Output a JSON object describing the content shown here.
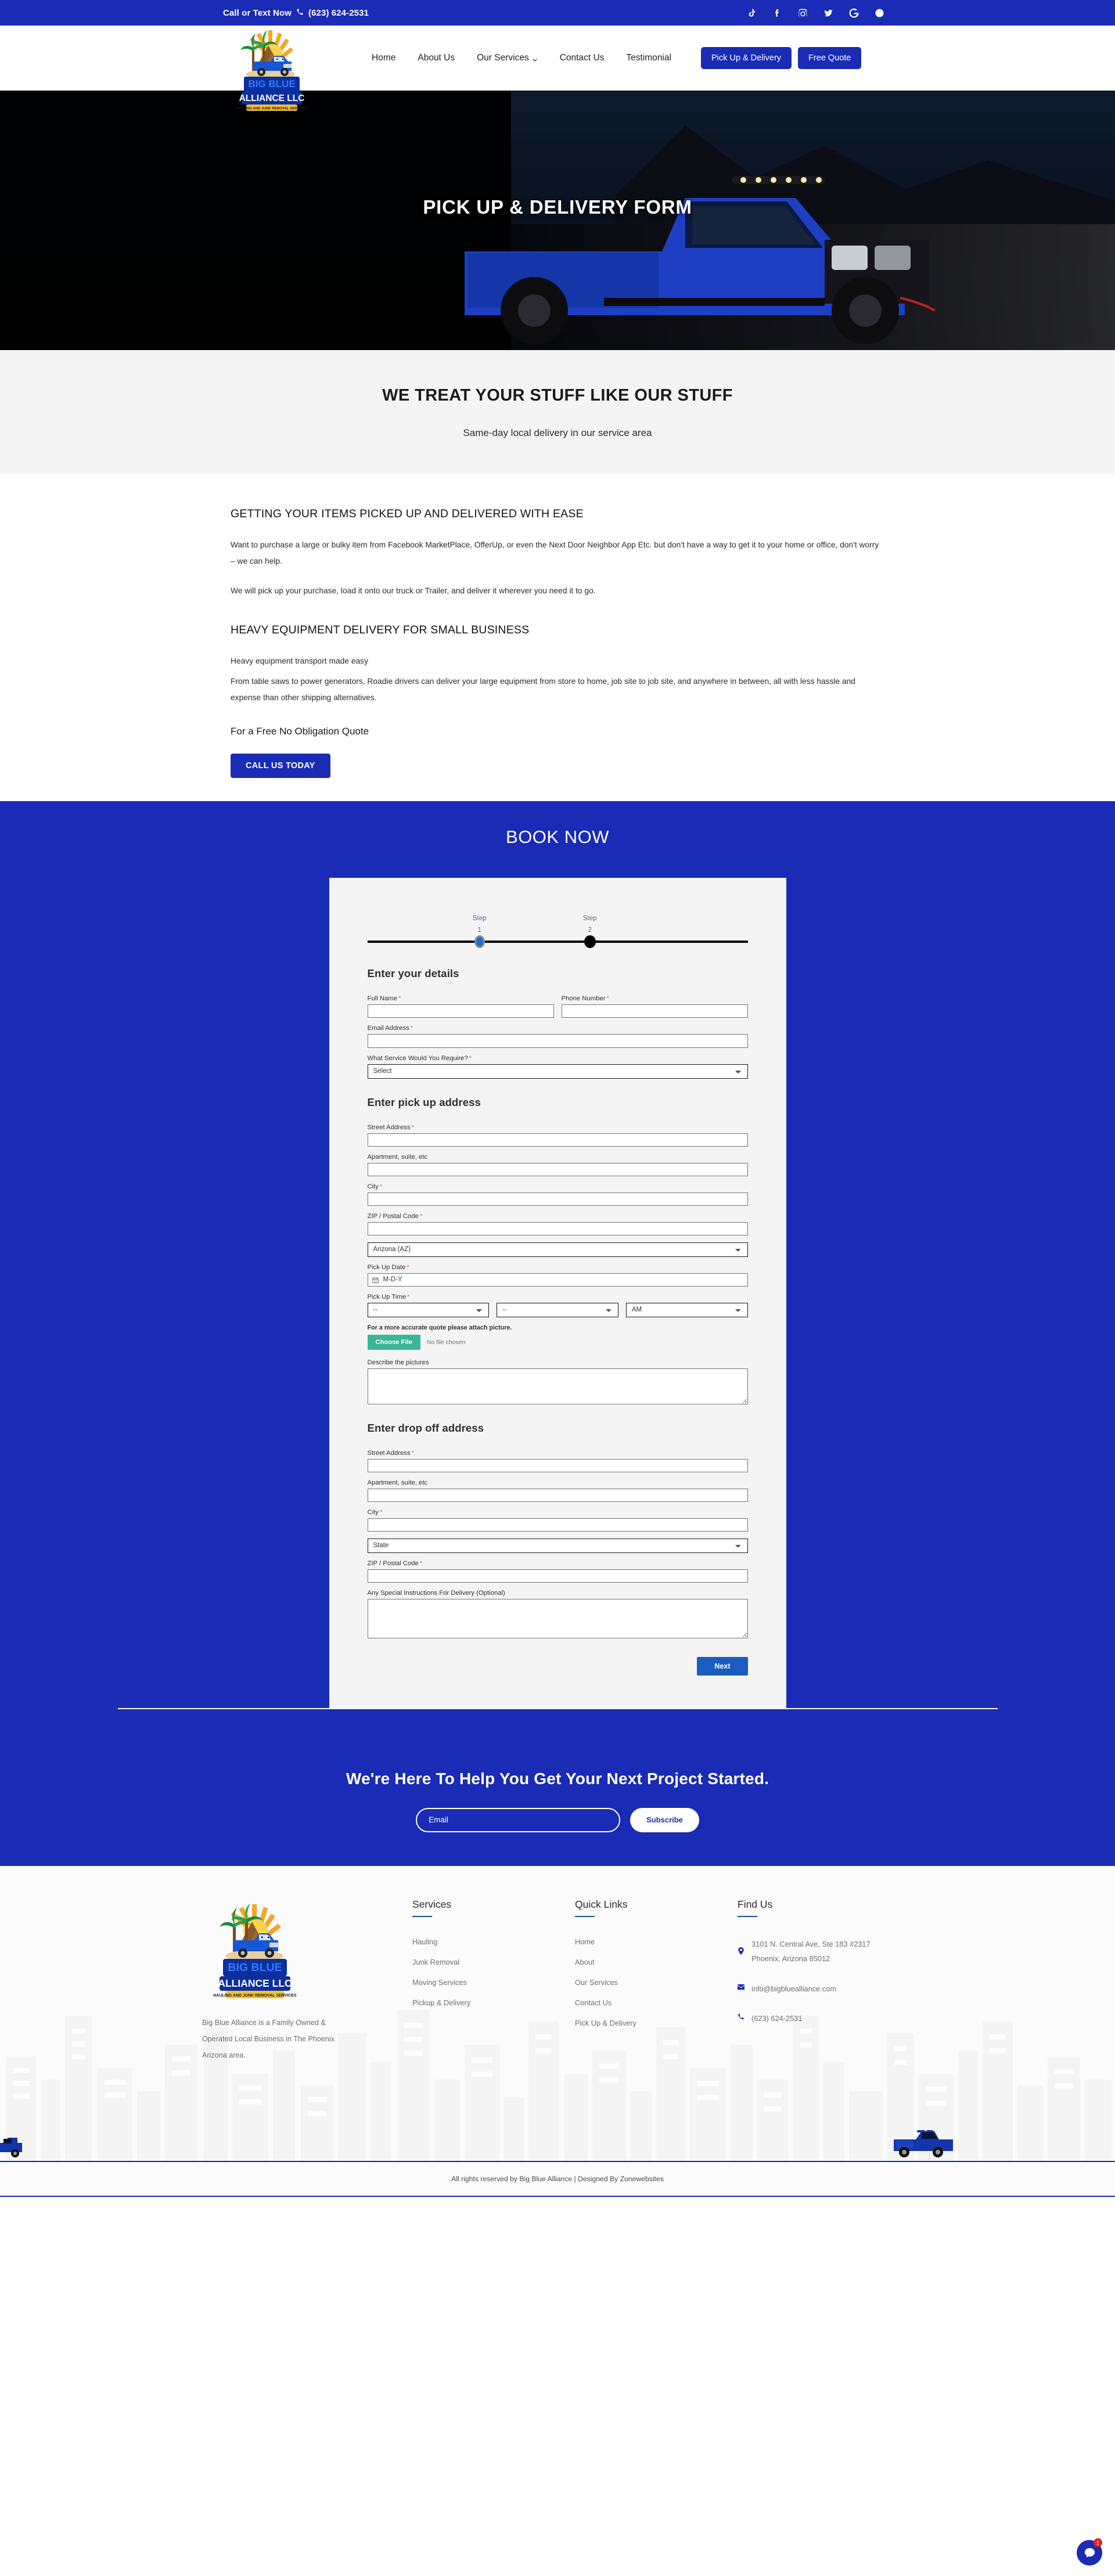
{
  "topbar": {
    "call_label": "Call or Text Now",
    "phone": "(623) 624-2531",
    "social": [
      {
        "name": "tiktok-icon",
        "label": "TikTok"
      },
      {
        "name": "facebook-icon",
        "label": "Facebook"
      },
      {
        "name": "instagram-icon",
        "label": "Instagram"
      },
      {
        "name": "twitter-icon",
        "label": "Twitter"
      },
      {
        "name": "google-icon",
        "label": "Google"
      },
      {
        "name": "location-pin-icon",
        "label": "Location"
      }
    ]
  },
  "header": {
    "logo_alt": "Big Blue Alliance LLC - Hauling and Junk Removal Services",
    "nav": [
      {
        "label": "Home",
        "has_dropdown": false
      },
      {
        "label": "About Us",
        "has_dropdown": false
      },
      {
        "label": "Our Services",
        "has_dropdown": true
      },
      {
        "label": "Contact Us",
        "has_dropdown": false
      },
      {
        "label": "Testimonial",
        "has_dropdown": false
      }
    ],
    "buttons": {
      "pickup": "Pick Up & Delivery",
      "quote": "Free Quote"
    }
  },
  "hero": {
    "title": "PICK UP & DELIVERY FORM"
  },
  "band": {
    "heading": "WE TREAT YOUR STUFF LIKE OUR STUFF",
    "subheading": "Same-day local delivery in our service area"
  },
  "info": {
    "heading1": "GETTING YOUR ITEMS PICKED UP AND DELIVERED WITH EASE",
    "para1": "Want to purchase a large or bulky item from Facebook MarketPlace, OfferUp, or even the Next Door Neighbor App Etc. but don't have a way to get it to your home or office, don't worry – we can help.",
    "para2": "We will pick up your purchase, load it onto our truck or Trailer, and deliver it wherever you need it to go.",
    "heading2": "HEAVY EQUIPMENT DELIVERY FOR SMALL BUSINESS",
    "para3": "Heavy equipment transport made easy",
    "para4": "From table saws to power generators, Roadie drivers can deliver your large equipment from store to home, job site to job site, and anywhere in between, all with less hassle and expense than other shipping alternatives.",
    "quote_heading": "For a Free No Obligation Quote",
    "cta_button": "CALL US TODAY"
  },
  "book": {
    "title": "BOOK NOW",
    "steps": [
      {
        "word": "Step",
        "num": "1",
        "state": "active"
      },
      {
        "word": "Step",
        "num": "2",
        "state": "inactive"
      }
    ],
    "details_title": "Enter your details",
    "fields": {
      "full_name": {
        "label": "Full Name",
        "required": true,
        "value": ""
      },
      "phone_number": {
        "label": "Phone Number",
        "required": true,
        "value": ""
      },
      "email_address": {
        "label": "Email Address",
        "required": true,
        "value": ""
      },
      "service": {
        "label": "What Service Would You Require?",
        "required": true,
        "value": "Select"
      }
    },
    "pickup_title": "Enter pick up address",
    "pickup": {
      "street": {
        "label": "Street Address",
        "required": true,
        "value": ""
      },
      "apartment": {
        "label": "Apartment, suite, etc",
        "required": false,
        "value": ""
      },
      "city": {
        "label": "City",
        "required": true,
        "value": ""
      },
      "zip": {
        "label": "ZIP / Postal Code",
        "required": true,
        "value": ""
      },
      "state": {
        "value": "Arizona (AZ)"
      },
      "date": {
        "label": "Pick Up Date",
        "required": true,
        "value": "M-D-Y"
      },
      "time": {
        "label": "Pick Up Time",
        "required": true,
        "hour": "--",
        "minute": "--",
        "meridiem": "AM"
      }
    },
    "attach": {
      "note": "For a more accurate quote please attach picture.",
      "button": "Choose File",
      "status": "No file chosen",
      "describe_label": "Describe the pictures",
      "describe_value": ""
    },
    "dropoff_title": "Enter drop off address",
    "dropoff": {
      "street": {
        "label": "Street Address",
        "required": true,
        "value": ""
      },
      "apartment": {
        "label": "Apartment, suite, etc",
        "required": false,
        "value": ""
      },
      "city": {
        "label": "City",
        "required": true,
        "value": ""
      },
      "state": {
        "value": "State"
      },
      "zip": {
        "label": "ZIP / Postal Code",
        "required": true,
        "value": ""
      },
      "instructions": {
        "label": "Any Special Instructions For Delivery (Optional)",
        "value": ""
      }
    },
    "next_button": "Next"
  },
  "cta": {
    "heading": "We're Here To Help You Get Your Next Project Started.",
    "email_placeholder": "Email",
    "subscribe_button": "Subscribe"
  },
  "footer": {
    "description": "Big Blue Alliance is a Family Owned & Operated Local Business in The Phoenix Arizona area.",
    "services": {
      "title": "Services",
      "items": [
        "Hauling",
        "Junk Removal",
        "Moving Services",
        "Pickup & Delivery"
      ]
    },
    "quick_links": {
      "title": "Quick Links",
      "items": [
        "Home",
        "About",
        "Our Services",
        "Contact Us",
        "Pick Up & Delivery"
      ]
    },
    "find_us": {
      "title": "Find Us",
      "address_line1": "3101 N. Central Ave, Ste 183 #2317",
      "address_line2": "Phoenix, Arizona 85012",
      "email": "info@bigbluealliance.com",
      "phone": "(623) 624-2531"
    },
    "copyright": "All rights reserved by Big Blue Alliance | Designed By Zonewebsites"
  },
  "widget": {
    "chat_label": "Chat",
    "badge": "1"
  },
  "colors": {
    "brand_blue": "#1a2bb5",
    "accent_green": "#3ab795",
    "next_blue": "#1a5cc0",
    "required_red": "#e0657e"
  }
}
